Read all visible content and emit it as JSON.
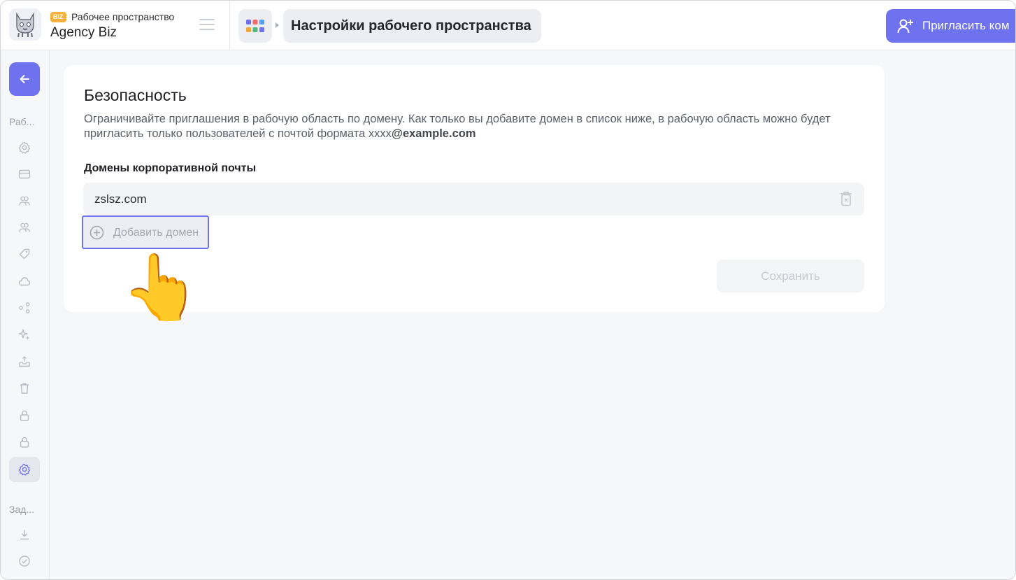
{
  "workspace": {
    "badge": "BIZ",
    "label": "Рабочее пространство",
    "name": "Agency Biz"
  },
  "breadcrumb": {
    "title": "Настройки рабочего пространства"
  },
  "header": {
    "invite_label": "Пригласить ком"
  },
  "sidebar": {
    "section_workspace": "Раб...",
    "section_tasks": "Зад...",
    "items": [
      {
        "icon": "gear-icon"
      },
      {
        "icon": "card-icon"
      },
      {
        "icon": "users-icon"
      },
      {
        "icon": "users-icon"
      },
      {
        "icon": "tag-icon"
      },
      {
        "icon": "cloud-icon"
      },
      {
        "icon": "share-icon"
      },
      {
        "icon": "sparkle-icon"
      },
      {
        "icon": "inbox-icon"
      },
      {
        "icon": "trash-icon"
      },
      {
        "icon": "lock-icon"
      },
      {
        "icon": "lock-icon"
      },
      {
        "icon": "gear-icon",
        "active": true
      }
    ],
    "task_items": [
      {
        "icon": "download-icon"
      },
      {
        "icon": "check-circle-icon"
      }
    ]
  },
  "security": {
    "title": "Безопасность",
    "description_text": "Ограничивайте приглашения в рабочую область по домену. Как только вы добавите домен в список ниже, в рабочую область можно будет пригласить только пользователей с почтой формата xxxx",
    "description_bold": "@example.com",
    "domains_label": "Домены корпоративной почты",
    "domains": [
      "zslsz.com"
    ],
    "add_domain_label": "Добавить домен",
    "save_label": "Сохранить"
  },
  "colors": {
    "accent": "#6f72ef",
    "badge": "#f6b23c"
  },
  "cursor": "👆"
}
